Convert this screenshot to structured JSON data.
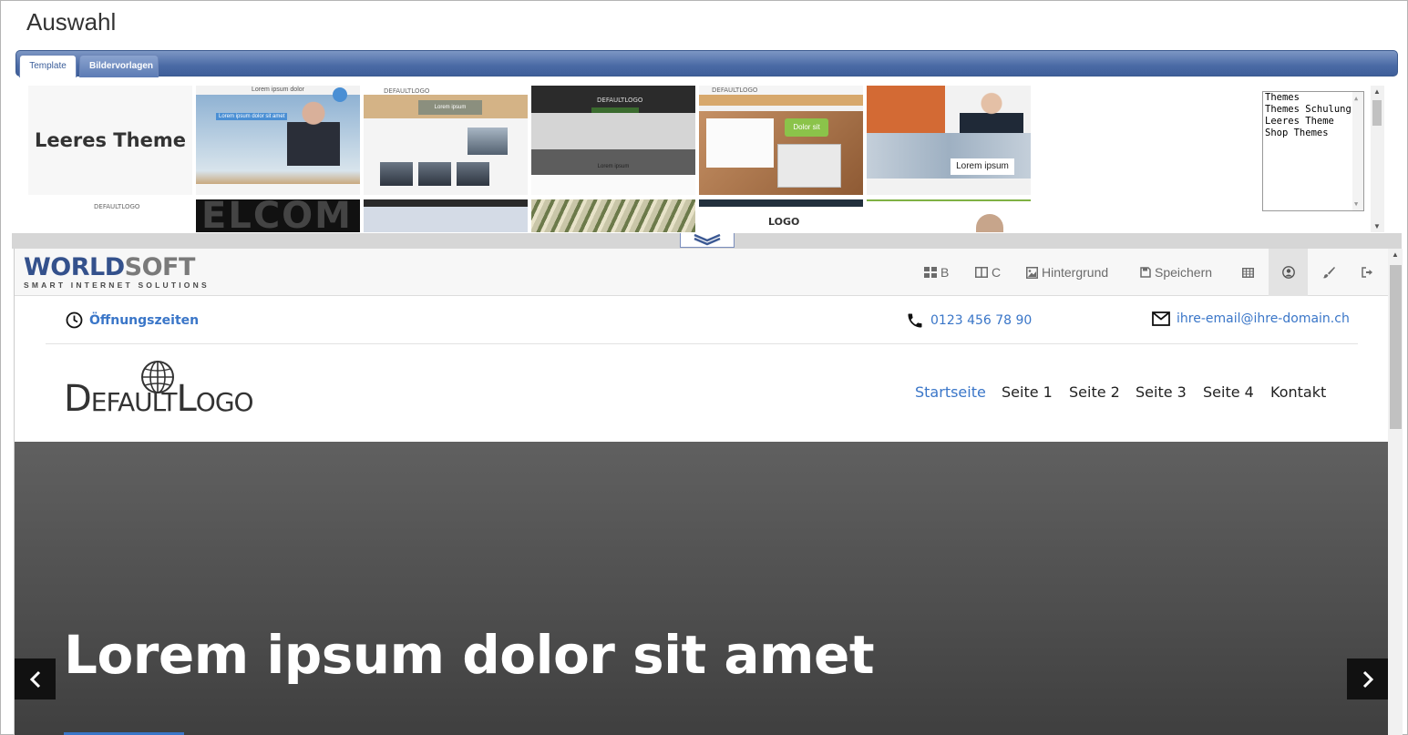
{
  "page": {
    "title": "Auswahl"
  },
  "tabs": {
    "template": "Template",
    "bildervorlagen": "Bildervorlagen"
  },
  "gallery": {
    "empty_theme": "Leeres Theme",
    "thumb_texts": {
      "man_top": "Lorem ipsum dolor",
      "man_headline": "Lorem ipsum dolor sit amet",
      "bridge_box": "Lorem ipsum",
      "city_caption": "Lorem ipsum",
      "desk_button": "Dolor sit",
      "office_label": "Lorem ipsum",
      "welcome": "ELCOM",
      "logo": "LOGO",
      "default_logo": "DEFAULTLOGO"
    }
  },
  "theme_list": {
    "items": [
      "Themes",
      "Themes Schulung",
      "Leeres Theme",
      "Shop Themes"
    ]
  },
  "editor_toolbar": {
    "brand_main": "WORLD",
    "brand_accent": "SOFT",
    "brand_sub": "SMART INTERNET SOLUTIONS",
    "items": {
      "b": "B",
      "c": "C",
      "hintergrund": "Hintergrund",
      "speichern": "Speichern"
    }
  },
  "site": {
    "opening_hours": "Öffnungszeiten",
    "phone": "0123 456 78 90",
    "email": "ihre-email@ihre-domain.ch",
    "logo_text": "DefaultLogo",
    "nav": [
      "Startseite",
      "Seite 1",
      "Seite 2",
      "Seite 3",
      "Seite 4",
      "Kontakt"
    ],
    "hero_title": "Lorem ipsum dolor sit amet"
  },
  "colors": {
    "accent": "#3a76c8",
    "tabbar": "#4a6aa5",
    "brand": "#34518c"
  }
}
